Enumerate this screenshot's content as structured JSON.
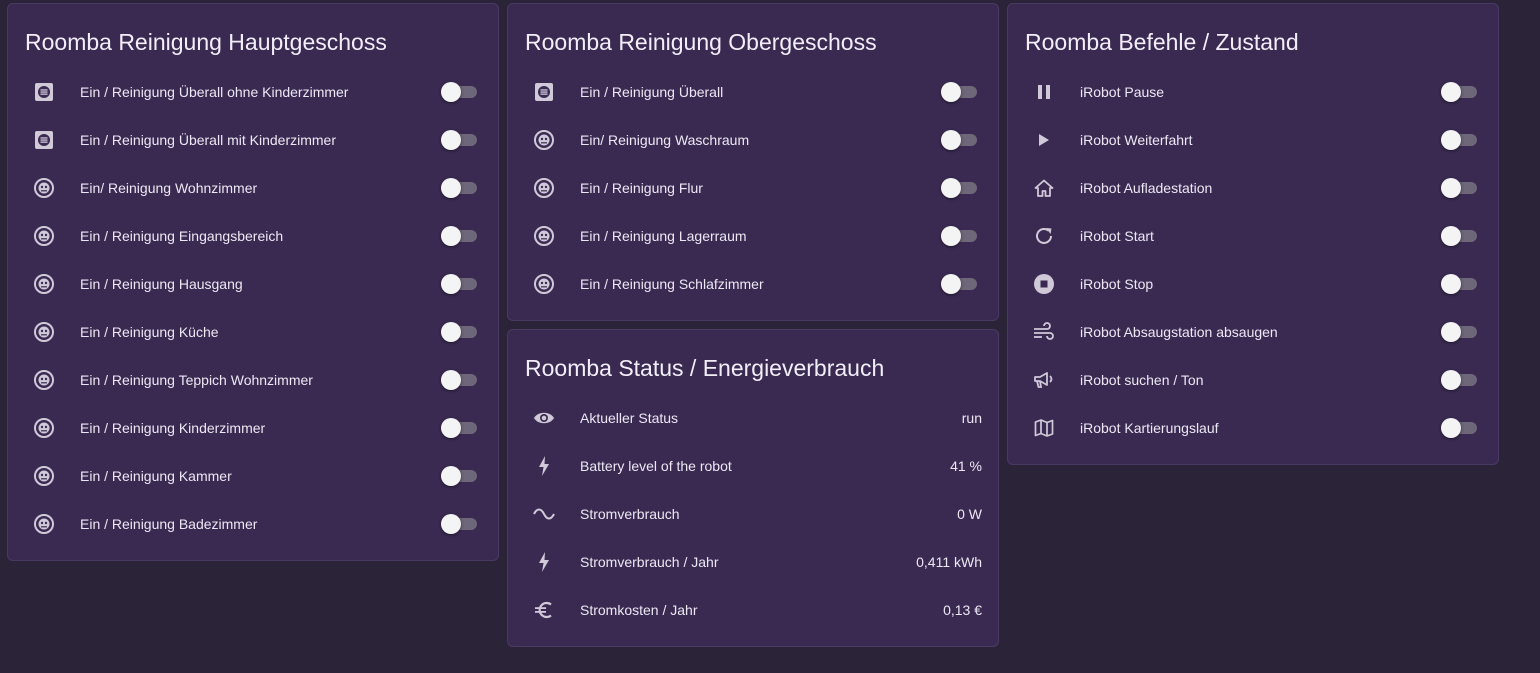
{
  "cards": {
    "haupt": {
      "title": "Roomba Reinigung Hauptgeschoss",
      "items": [
        {
          "label": "Ein / Reinigung Überall ohne Kinderzimmer",
          "icon": "list-box-icon",
          "state": "off"
        },
        {
          "label": "Ein / Reinigung Überall mit Kinderzimmer",
          "icon": "list-box-icon",
          "state": "off"
        },
        {
          "label": "Ein/ Reinigung Wohnzimmer",
          "icon": "robot-vacuum-icon",
          "state": "off"
        },
        {
          "label": "Ein / Reinigung Eingangsbereich",
          "icon": "robot-vacuum-icon",
          "state": "off"
        },
        {
          "label": "Ein / Reinigung Hausgang",
          "icon": "robot-vacuum-icon",
          "state": "off"
        },
        {
          "label": "Ein / Reinigung Küche",
          "icon": "robot-vacuum-icon",
          "state": "off"
        },
        {
          "label": "Ein / Reinigung Teppich Wohnzimmer",
          "icon": "robot-vacuum-icon",
          "state": "off"
        },
        {
          "label": "Ein / Reinigung Kinderzimmer",
          "icon": "robot-vacuum-icon",
          "state": "off"
        },
        {
          "label": "Ein / Reinigung Kammer",
          "icon": "robot-vacuum-icon",
          "state": "off"
        },
        {
          "label": "Ein / Reinigung Badezimmer",
          "icon": "robot-vacuum-icon",
          "state": "off"
        }
      ]
    },
    "ober": {
      "title": "Roomba Reinigung Obergeschoss",
      "items": [
        {
          "label": "Ein / Reinigung Überall",
          "icon": "list-box-icon",
          "state": "off"
        },
        {
          "label": "Ein/ Reinigung Waschraum",
          "icon": "robot-vacuum-icon",
          "state": "off"
        },
        {
          "label": "Ein / Reinigung Flur",
          "icon": "robot-vacuum-icon",
          "state": "off"
        },
        {
          "label": "Ein / Reinigung Lagerraum",
          "icon": "robot-vacuum-icon",
          "state": "off"
        },
        {
          "label": "Ein / Reinigung Schlafzimmer",
          "icon": "robot-vacuum-icon",
          "state": "off"
        }
      ]
    },
    "status": {
      "title": "Roomba Status / Energieverbrauch",
      "items": [
        {
          "label": "Aktueller Status",
          "value": "run",
          "icon": "eye-icon"
        },
        {
          "label": "Battery level of the robot",
          "value": "41 %",
          "icon": "flash-icon"
        },
        {
          "label": "Stromverbrauch",
          "value": "0 W",
          "icon": "sine-wave-icon"
        },
        {
          "label": "Stromverbrauch / Jahr",
          "value": "0,411 kWh",
          "icon": "flash-icon"
        },
        {
          "label": "Stromkosten / Jahr",
          "value": "0,13 €",
          "icon": "euro-icon"
        }
      ]
    },
    "befehle": {
      "title": "Roomba Befehle / Zustand",
      "items": [
        {
          "label": "iRobot Pause",
          "icon": "pause-icon",
          "state": "off"
        },
        {
          "label": "iRobot Weiterfahrt",
          "icon": "play-icon",
          "state": "off"
        },
        {
          "label": "iRobot Aufladestation",
          "icon": "home-icon",
          "state": "off"
        },
        {
          "label": "iRobot Start",
          "icon": "refresh-icon",
          "state": "off"
        },
        {
          "label": "iRobot Stop",
          "icon": "stop-circle-icon",
          "state": "off"
        },
        {
          "label": "iRobot Absaugstation absaugen",
          "icon": "wind-icon",
          "state": "off"
        },
        {
          "label": "iRobot suchen / Ton",
          "icon": "bullhorn-icon",
          "state": "off"
        },
        {
          "label": "iRobot Kartierungslauf",
          "icon": "map-icon",
          "state": "off"
        }
      ]
    }
  },
  "colors": {
    "background": "#2b2338",
    "card": "#3a2a52",
    "icon": "#cfc9d8",
    "toggle_track_off": "#6e6679",
    "toggle_knob": "#f4f4f4"
  }
}
